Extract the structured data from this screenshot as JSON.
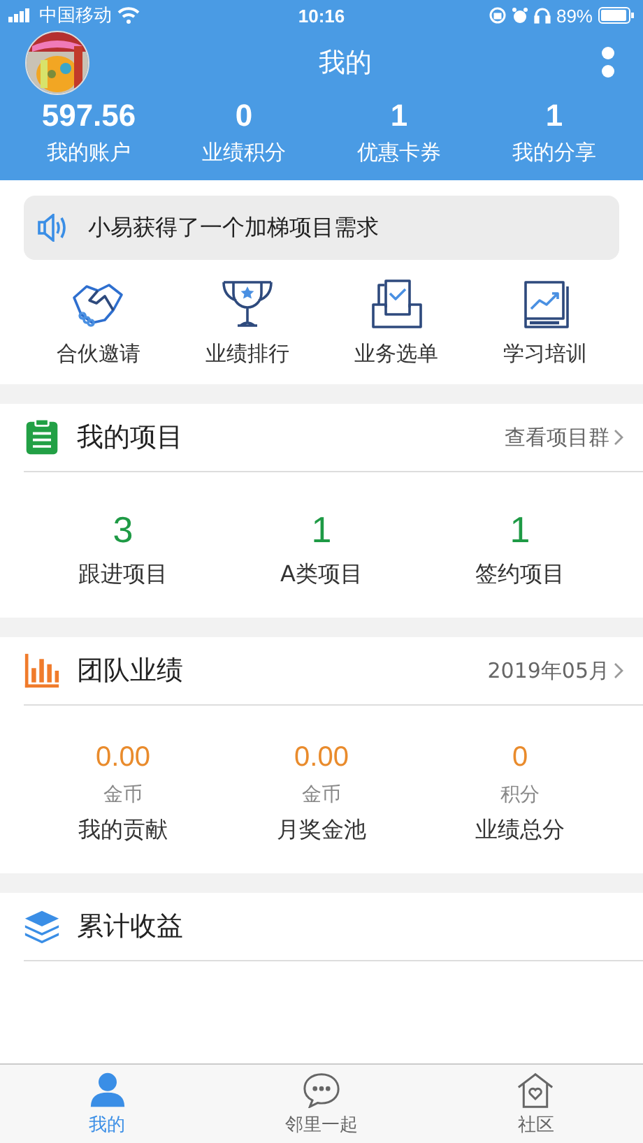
{
  "status_bar": {
    "carrier": "中国移动",
    "time": "10:16",
    "battery": "89%"
  },
  "header": {
    "title": "我的"
  },
  "stats": [
    {
      "value": "597.56",
      "label": "我的账户"
    },
    {
      "value": "0",
      "label": "业绩积分"
    },
    {
      "value": "1",
      "label": "优惠卡券"
    },
    {
      "value": "1",
      "label": "我的分享"
    }
  ],
  "notice": {
    "text": "小易获得了一个加梯项目需求"
  },
  "shortcuts": [
    {
      "kind": "handshake",
      "label": "合伙邀请"
    },
    {
      "kind": "trophy",
      "label": "业绩排行"
    },
    {
      "kind": "tray",
      "label": "业务选单"
    },
    {
      "kind": "book",
      "label": "学习培训"
    }
  ],
  "sections": [
    {
      "kind": "projects",
      "title": "我的项目",
      "link": "查看项目群",
      "items": [
        {
          "value": "3",
          "label": "跟进项目"
        },
        {
          "value": "1",
          "label": "A类项目"
        },
        {
          "value": "1",
          "label": "签约项目"
        }
      ]
    },
    {
      "kind": "team",
      "title": "团队业绩",
      "link": "2019年05月",
      "items": [
        {
          "value": "0.00",
          "unit": "金币",
          "label": "我的贡献"
        },
        {
          "value": "0.00",
          "unit": "金币",
          "label": "月奖金池"
        },
        {
          "value": "0",
          "unit": "积分",
          "label": "业绩总分"
        }
      ]
    },
    {
      "kind": "earnings",
      "title": "累计收益"
    }
  ],
  "tab_bar": [
    {
      "kind": "person",
      "label": "我的",
      "selected": true
    },
    {
      "kind": "chat",
      "label": "邻里一起",
      "selected": false
    },
    {
      "kind": "home",
      "label": "社区",
      "selected": false
    }
  ]
}
